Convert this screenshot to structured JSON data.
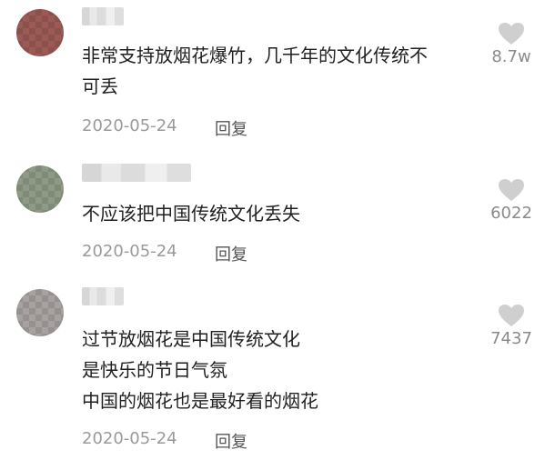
{
  "comments": [
    {
      "username": "",
      "text": "非常支持放烟花爆竹，几千年的文化传统不\n可丢",
      "date": "2020-05-24",
      "reply_label": "回复",
      "like_count": "8.7w",
      "like_icon": "heart-icon"
    },
    {
      "username": "",
      "text": "不应该把中国传统文化丢失",
      "date": "2020-05-24",
      "reply_label": "回复",
      "like_count": "6022",
      "like_icon": "heart-icon"
    },
    {
      "username": "",
      "text": "过节放烟花是中国传统文化\n是快乐的节日气氛\n中国的烟花也是最好看的烟花",
      "date": "2020-05-24",
      "reply_label": "回复",
      "like_count": "7437",
      "like_icon": "heart-icon"
    }
  ],
  "colors": {
    "text": "#1f1f1f",
    "meta": "#9a9a9a",
    "heart": "#cfcfcf"
  }
}
